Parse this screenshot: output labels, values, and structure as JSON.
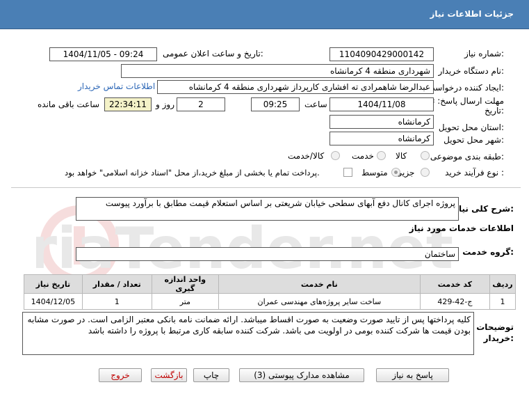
{
  "title": "جزئیات اطلاعات نیاز",
  "need_number": {
    "label": "شماره نیاز:",
    "value": "1104090429000142"
  },
  "announce_date": {
    "label": "تاریخ و ساعت اعلان عمومی:",
    "value": "1404/11/05 - 09:24"
  },
  "buyer_org": {
    "label": "نام دستگاه خریدار:",
    "value": "شهرداری منطقه 4 کرمانشاه"
  },
  "requester": {
    "label": "ایجاد کننده درخواست:",
    "value": "عبدالرضا شاهمرادی ته افشاری کارپرداز شهرداری منطقه 4 کرمانشاه",
    "contact_link": "اطلاعات تماس خریدار"
  },
  "deadline": {
    "label_line1": "مهلت ارسال پاسخ: تا",
    "label_line2": "تاریخ:",
    "date": "1404/11/08",
    "time_label": "ساعت",
    "time": "09:25",
    "days": "2",
    "days_label": "روز و",
    "remaining": "22:34:11",
    "remaining_label": "ساعت باقی مانده"
  },
  "delivery_province": {
    "label": "استان محل تحویل:",
    "value": "کرمانشاه"
  },
  "delivery_city": {
    "label": "شهر محل تحویل:",
    "value": "کرمانشاه"
  },
  "category": {
    "label": "طبقه بندی موضوعی:",
    "options": [
      "کالا",
      "خدمت",
      "کالا/خدمت"
    ],
    "selected": "خدمت"
  },
  "purchase_type": {
    "label": "نوع فرآیند خرید :",
    "options": [
      "جزیی",
      "متوسط"
    ],
    "selected": "متوسط",
    "treasury_note": "پرداخت تمام یا بخشی از مبلغ خرید،از محل \"اسناد خزانه اسلامی\" خواهد بود."
  },
  "description": {
    "label": "شرح کلی نیاز:",
    "value": "پروژه اجرای کانال دفع آبهای سطحی خیابان شریعتی بر اساس استعلام قیمت مطابق با برآورد پیوست"
  },
  "services_heading": "اطلاعات خدمات مورد نیاز",
  "service_group": {
    "label": "گروه خدمت:",
    "value": "ساختمان"
  },
  "table": {
    "headers": [
      "ردیف",
      "کد خدمت",
      "نام خدمت",
      "واحد اندازه گیری",
      "تعداد / مقدار",
      "تاریخ نیاز"
    ],
    "rows": [
      [
        "1",
        "ج-42-429",
        "ساخت سایر پروژه‌های مهندسی عمران",
        "متر",
        "1",
        "1404/12/05"
      ]
    ]
  },
  "buyer_notes": {
    "label_line1": "توضیحات",
    "label_line2": "خریدار:",
    "value": "کلیه پرداختها پس از تایید صورت وضعیت به صورت اقساط میباشد. ارائه ضمانت نامه بانکی معتبر الزامی است. در صورت مشابه بودن قیمت ها شرکت کننده بومی در اولویت می باشد. شرکت کننده سابقه کاری مرتبط با پروژه را داشته باشد"
  },
  "buttons": {
    "reply": "پاسخ به نیاز",
    "attachments": "مشاهده مدارک پیوستی (3)",
    "print": "چاپ",
    "back": "بازگشت",
    "exit": "خروج"
  },
  "watermark": "AriaTender.net"
}
